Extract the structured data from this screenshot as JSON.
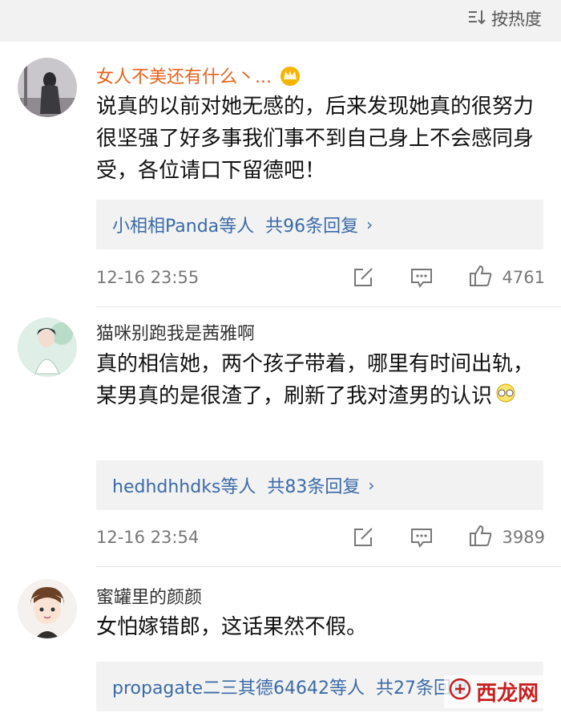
{
  "header": {
    "sort_label": "按热度"
  },
  "comments": [
    {
      "username": "女人不美还有什么丶...",
      "text": "说真的以前对她无感的，后来发现她真的很努力很坚强了好多事我们事不到自己身上不会感同身受，各位请口下留德吧！",
      "replies_users": "小相相Panda等人",
      "replies_count": "共96条回复",
      "time": "12-16 23:55",
      "likes": "4761"
    },
    {
      "username": "猫咪别跑我是茜雅啊",
      "text": "真的相信她，两个孩子带着，哪里有时间出轨，某男真的是很渣了，刷新了我对渣男的认识",
      "replies_users": "hedhdhhdks等人",
      "replies_count": "共83条回复",
      "time": "12-16 23:54",
      "likes": "3989"
    },
    {
      "username": "蜜罐里的颜颜",
      "text": "女怕嫁错郎，这话果然不假。",
      "replies_users": "propagate二三其德64642等人",
      "replies_count": "共27条回复"
    }
  ],
  "watermark": {
    "text": "西龙网"
  },
  "colors": {
    "link": "#3b6aa8",
    "vip_name": "#e8611a",
    "meta": "#777777",
    "panel": "#f2f2f2"
  },
  "icons": [
    "sort-icon",
    "crown-icon",
    "chevron-right-icon",
    "share-icon",
    "comment-icon",
    "like-icon",
    "emoji-icon"
  ]
}
